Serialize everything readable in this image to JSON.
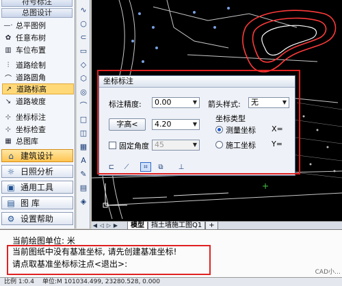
{
  "left_panel": {
    "header_top": "符号标注",
    "header_general": "总图设计",
    "items": [
      {
        "label": "总平图例",
        "icon": "—·"
      },
      {
        "label": "任意布树",
        "icon": "✿"
      },
      {
        "label": "车位布置",
        "icon": "▥"
      },
      {
        "label": "道路绘制",
        "icon": "⫶"
      },
      {
        "label": "道路圆角",
        "icon": "⌒"
      },
      {
        "label": "道路标高",
        "icon": "↗"
      },
      {
        "label": "道路坡度",
        "icon": "↘"
      },
      {
        "label": "坐标标注",
        "icon": "⊹"
      },
      {
        "label": "坐标检查",
        "icon": "⊹"
      },
      {
        "label": "总图库",
        "icon": "▦"
      }
    ],
    "big_buttons": [
      {
        "label": "建筑设计",
        "icon": "⌂"
      },
      {
        "label": "日照分析",
        "icon": "☼"
      },
      {
        "label": "通用工具",
        "icon": "▣"
      },
      {
        "label": "图    库",
        "icon": "▤"
      },
      {
        "label": "设置帮助",
        "icon": "⚙"
      }
    ]
  },
  "vertical_toolbar": [
    "∿",
    "○",
    "⊂",
    "▭",
    "◇",
    "⬡",
    "◎",
    "⌒",
    "□",
    "◫",
    "▦",
    "A",
    "✎",
    "▤",
    "◈"
  ],
  "dialog": {
    "title": "坐标标注",
    "precision_label": "标注精度:",
    "precision_value": "0.00",
    "arrow_style_label": "箭头样式:",
    "arrow_style_value": "无",
    "char_height_button": "字高<",
    "char_height_value": "4.20",
    "coord_type_label": "坐标类型",
    "radio_measure": "测量坐标",
    "radio_construction": "施工坐标",
    "x_label": "X=",
    "y_label": "Y=",
    "fixed_angle_label": "固定角度",
    "fixed_angle_value": "45"
  },
  "tabs": {
    "model_tab": "模型",
    "drawing_tab": "挡土墙施工图Q1",
    "add_tab": "+"
  },
  "command": {
    "line1": "当前绘图单位: 米",
    "line2": "当前图纸中没有基准坐标, 请先创建基准坐标!",
    "line3": "请点取基准坐标标注点<退出>:"
  },
  "status": {
    "scale": "比例 1:0.4",
    "coords": "单位:M  101034.499, 23280.528, 0.000"
  },
  "watermark": "CAD小…"
}
